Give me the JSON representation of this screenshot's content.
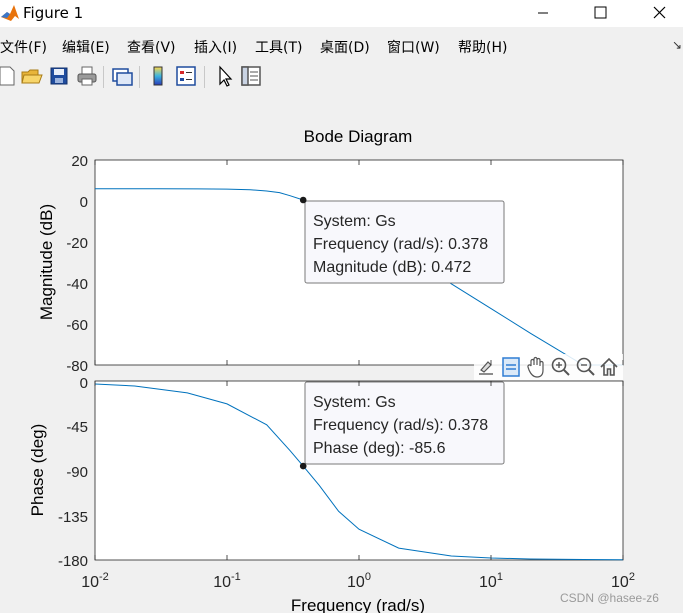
{
  "window": {
    "title": "Figure 1",
    "icon": "matlab-logo-icon",
    "controls": [
      "minimize-icon",
      "maximize-icon",
      "close-icon"
    ]
  },
  "menubar": {
    "items": [
      {
        "label": "文件(F)"
      },
      {
        "label": "编辑(E)"
      },
      {
        "label": "查看(V)"
      },
      {
        "label": "插入(I)"
      },
      {
        "label": "工具(T)"
      },
      {
        "label": "桌面(D)"
      },
      {
        "label": "窗口(W)"
      },
      {
        "label": "帮助(H)"
      }
    ],
    "overflow_icon": "menu-overflow-arrow-icon"
  },
  "toolbar": {
    "icons": [
      "new-figure-icon",
      "open-file-icon",
      "save-icon",
      "print-icon",
      "link-plot-icon",
      "insert-colorbar-icon",
      "insert-legend-icon",
      "edit-plot-arrow-icon",
      "property-inspector-icon"
    ]
  },
  "axes_toolbar": {
    "icons": [
      "export-brush-icon",
      "data-tips-icon",
      "pan-hand-icon",
      "zoom-in-icon",
      "zoom-out-icon",
      "home-restore-icon"
    ]
  },
  "chart_data": {
    "type": "line",
    "title": "Bode Diagram",
    "xlabel": "Frequency  (rad/s)",
    "x_scale": "log",
    "xlim": [
      0.01,
      100
    ],
    "x_ticks": [
      "10",
      "10",
      "10",
      "10",
      "10"
    ],
    "x_tick_exponents": [
      "-2",
      "-1",
      "0",
      "1",
      "2"
    ],
    "magnitude": {
      "ylabel": "Magnitude (dB)",
      "ylim": [
        -80,
        20
      ],
      "y_ticks": [
        "20",
        "0",
        "-20",
        "-40",
        "-60",
        "-80"
      ],
      "series": [
        {
          "x": [
            0.01,
            0.03,
            0.06,
            0.1,
            0.15,
            0.2,
            0.25,
            0.3,
            0.378,
            0.5,
            0.7,
            1,
            2,
            5,
            10,
            20,
            50,
            100
          ],
          "y": [
            6,
            6,
            5.9,
            5.8,
            5.5,
            4.9,
            4.1,
            2.6,
            0.472,
            -2.6,
            -7.2,
            -12.4,
            -24.5,
            -40.4,
            -52.5,
            -64.6,
            -80.5,
            -92.5
          ]
        }
      ],
      "datatip": {
        "system_line": "System: Gs",
        "frequency_line": "Frequency (rad/s): 0.378",
        "value_line": "Magnitude (dB): 0.472",
        "x": 0.378,
        "y": 0.472
      }
    },
    "phase": {
      "ylabel": "Phase (deg)",
      "ylim": [
        -180,
        0
      ],
      "y_ticks": [
        "0",
        "-45",
        "-90",
        "-135",
        "-180"
      ],
      "series": [
        {
          "x": [
            0.01,
            0.02,
            0.05,
            0.1,
            0.2,
            0.3,
            0.378,
            0.5,
            0.7,
            1,
            2,
            5,
            10,
            20,
            50,
            100
          ],
          "y": [
            -3,
            -5,
            -12,
            -23,
            -44,
            -70,
            -85.6,
            -105,
            -131,
            -149,
            -168,
            -176,
            -178,
            -179,
            -179.5,
            -179.8
          ]
        }
      ],
      "datatip": {
        "system_line": "System: Gs",
        "frequency_line": "Frequency (rad/s): 0.378",
        "value_line": "Phase (deg): -85.6",
        "x": 0.378,
        "y": -85.6
      }
    },
    "line_color": "#0072bd",
    "grid": false
  },
  "watermark": "CSDN @hasee-z6"
}
